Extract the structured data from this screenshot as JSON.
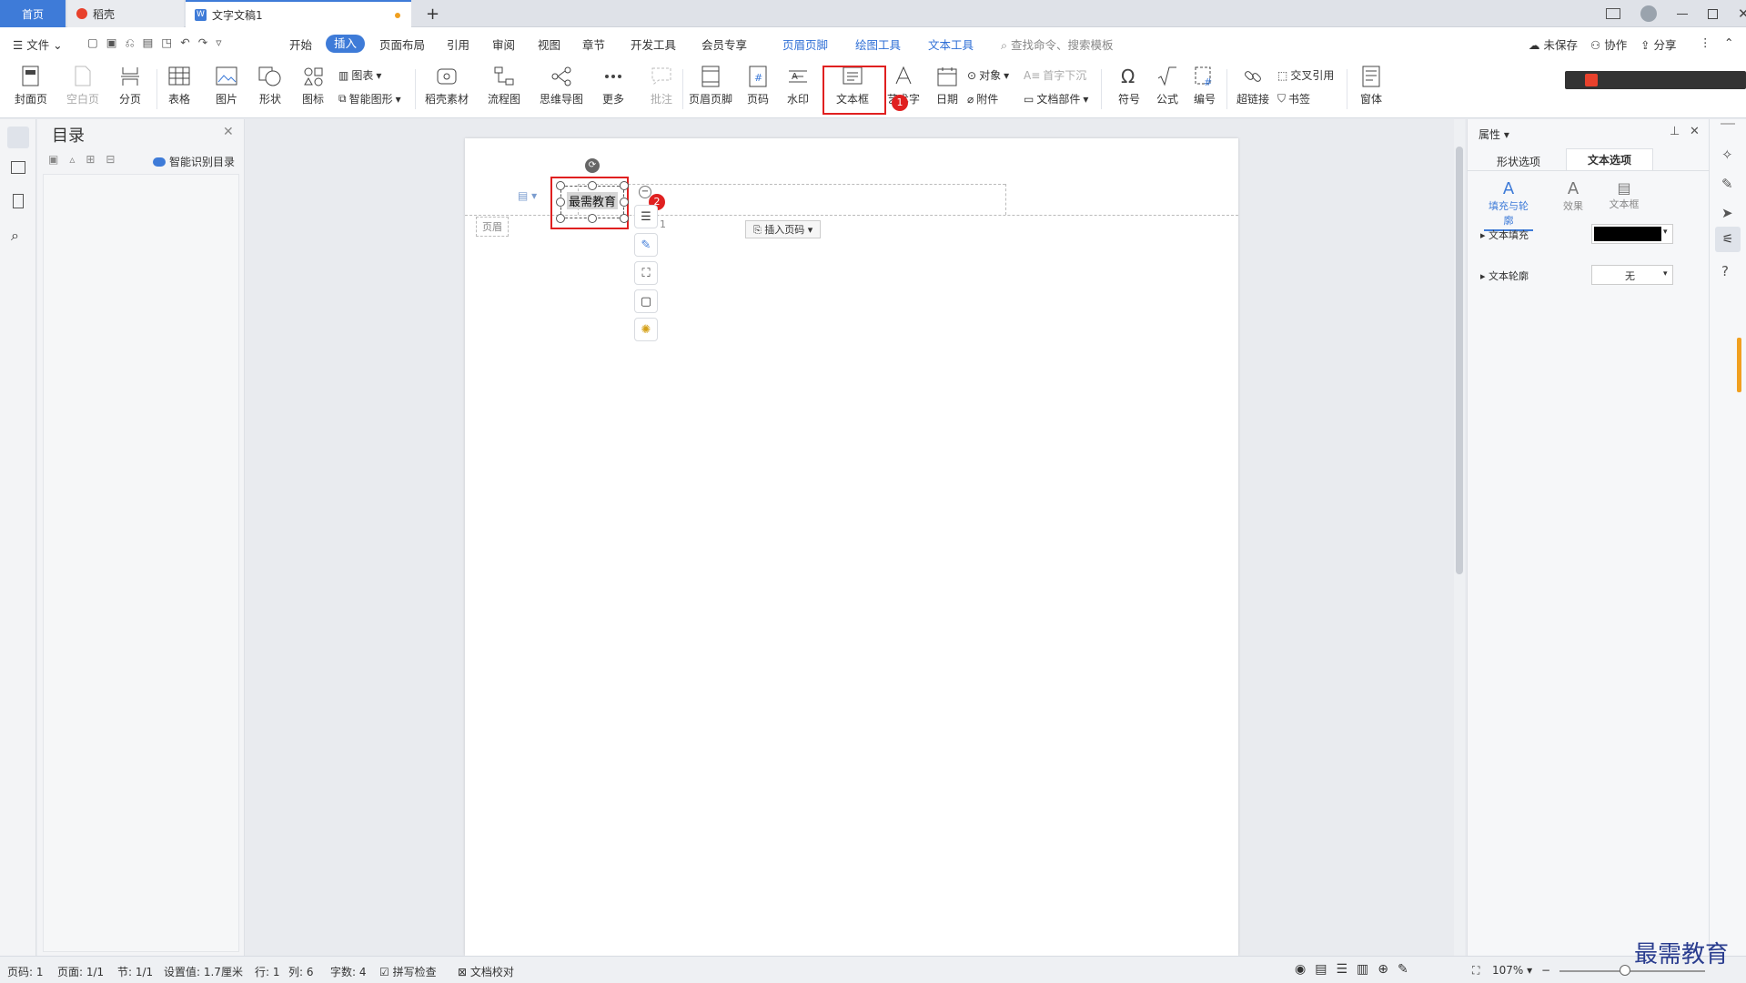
{
  "tabs": {
    "home": "首页",
    "daoke": "稻壳",
    "doc": "文字文稿1",
    "new": "+"
  },
  "menu": {
    "file": "文件",
    "items": [
      "开始",
      "插入",
      "页面布局",
      "引用",
      "审阅",
      "视图",
      "章节",
      "开发工具",
      "会员专享"
    ],
    "context": [
      "页眉页脚",
      "绘图工具",
      "文本工具"
    ],
    "search": "查找命令、搜索模板",
    "unsaved": "未保存",
    "collab": "协作",
    "share": "分享"
  },
  "ribbon": {
    "cover": "封面页",
    "blank": "空白页",
    "pagebreak": "分页",
    "table": "表格",
    "picture": "图片",
    "shape": "形状",
    "icon": "图标",
    "chart": "图表",
    "smartart": "智能图形",
    "material": "稻壳素材",
    "flow": "流程图",
    "mindmap": "思维导图",
    "more": "更多",
    "comment": "批注",
    "headerfooter": "页眉页脚",
    "pagenum": "页码",
    "watermark": "水印",
    "textbox": "文本框",
    "art": "艺术字",
    "date": "日期",
    "object": "对象",
    "dropcap": "首字下沉",
    "attach": "附件",
    "docpart": "文档部件",
    "symbol": "符号",
    "formula": "公式",
    "numbering": "编号",
    "hyperlink": "超链接",
    "crossref": "交叉引用",
    "bookmark": "书签",
    "window": "窗体"
  },
  "badges": {
    "one": "1",
    "two": "2"
  },
  "toc": {
    "title": "目录",
    "smart": "智能识别目录"
  },
  "doc": {
    "textbox_text": "最需教育",
    "header_label": "页眉",
    "insert_pagenum": "插入页码",
    "page_hint": "1"
  },
  "props": {
    "title": "属性",
    "tab_shape": "形状选项",
    "tab_text": "文本选项",
    "sub_fill": "填充与轮廓",
    "sub_effect": "效果",
    "sub_box": "文本框",
    "fill_label": "文本填充",
    "outline_label": "文本轮廓",
    "outline_value": "无",
    "fill_color": "#000000"
  },
  "status": {
    "pagecode": "页码: 1",
    "page": "页面: 1/1",
    "section": "节: 1/1",
    "setting": "设置值: 1.7厘米",
    "row": "行: 1",
    "col": "列: 6",
    "words": "字数: 4",
    "spell": "拼写检查",
    "proof": "文档校对",
    "zoom": "107%"
  },
  "watermark": "最需教育",
  "colors": {
    "accent": "#3e7bd8",
    "red": "#e02020"
  }
}
